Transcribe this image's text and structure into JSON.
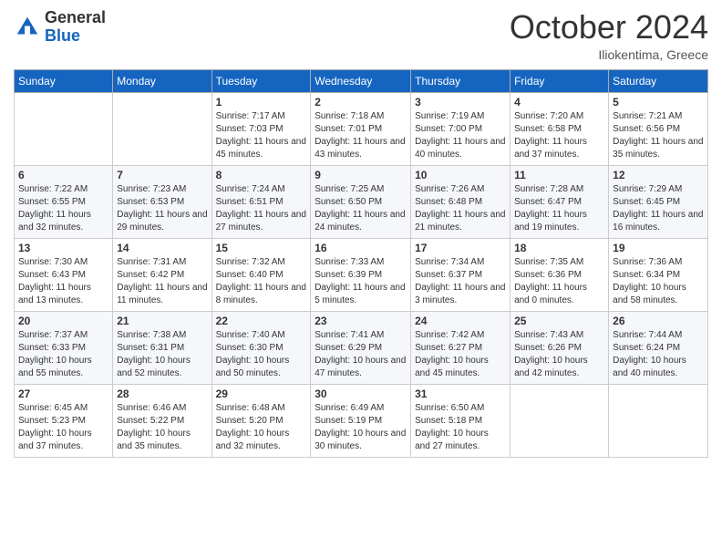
{
  "logo": {
    "general": "General",
    "blue": "Blue"
  },
  "title": "October 2024",
  "location": "Iliokentima, Greece",
  "days_of_week": [
    "Sunday",
    "Monday",
    "Tuesday",
    "Wednesday",
    "Thursday",
    "Friday",
    "Saturday"
  ],
  "weeks": [
    [
      {
        "day": "",
        "info": ""
      },
      {
        "day": "",
        "info": ""
      },
      {
        "day": "1",
        "sunrise": "Sunrise: 7:17 AM",
        "sunset": "Sunset: 7:03 PM",
        "daylight": "Daylight: 11 hours and 45 minutes."
      },
      {
        "day": "2",
        "sunrise": "Sunrise: 7:18 AM",
        "sunset": "Sunset: 7:01 PM",
        "daylight": "Daylight: 11 hours and 43 minutes."
      },
      {
        "day": "3",
        "sunrise": "Sunrise: 7:19 AM",
        "sunset": "Sunset: 7:00 PM",
        "daylight": "Daylight: 11 hours and 40 minutes."
      },
      {
        "day": "4",
        "sunrise": "Sunrise: 7:20 AM",
        "sunset": "Sunset: 6:58 PM",
        "daylight": "Daylight: 11 hours and 37 minutes."
      },
      {
        "day": "5",
        "sunrise": "Sunrise: 7:21 AM",
        "sunset": "Sunset: 6:56 PM",
        "daylight": "Daylight: 11 hours and 35 minutes."
      }
    ],
    [
      {
        "day": "6",
        "sunrise": "Sunrise: 7:22 AM",
        "sunset": "Sunset: 6:55 PM",
        "daylight": "Daylight: 11 hours and 32 minutes."
      },
      {
        "day": "7",
        "sunrise": "Sunrise: 7:23 AM",
        "sunset": "Sunset: 6:53 PM",
        "daylight": "Daylight: 11 hours and 29 minutes."
      },
      {
        "day": "8",
        "sunrise": "Sunrise: 7:24 AM",
        "sunset": "Sunset: 6:51 PM",
        "daylight": "Daylight: 11 hours and 27 minutes."
      },
      {
        "day": "9",
        "sunrise": "Sunrise: 7:25 AM",
        "sunset": "Sunset: 6:50 PM",
        "daylight": "Daylight: 11 hours and 24 minutes."
      },
      {
        "day": "10",
        "sunrise": "Sunrise: 7:26 AM",
        "sunset": "Sunset: 6:48 PM",
        "daylight": "Daylight: 11 hours and 21 minutes."
      },
      {
        "day": "11",
        "sunrise": "Sunrise: 7:28 AM",
        "sunset": "Sunset: 6:47 PM",
        "daylight": "Daylight: 11 hours and 19 minutes."
      },
      {
        "day": "12",
        "sunrise": "Sunrise: 7:29 AM",
        "sunset": "Sunset: 6:45 PM",
        "daylight": "Daylight: 11 hours and 16 minutes."
      }
    ],
    [
      {
        "day": "13",
        "sunrise": "Sunrise: 7:30 AM",
        "sunset": "Sunset: 6:43 PM",
        "daylight": "Daylight: 11 hours and 13 minutes."
      },
      {
        "day": "14",
        "sunrise": "Sunrise: 7:31 AM",
        "sunset": "Sunset: 6:42 PM",
        "daylight": "Daylight: 11 hours and 11 minutes."
      },
      {
        "day": "15",
        "sunrise": "Sunrise: 7:32 AM",
        "sunset": "Sunset: 6:40 PM",
        "daylight": "Daylight: 11 hours and 8 minutes."
      },
      {
        "day": "16",
        "sunrise": "Sunrise: 7:33 AM",
        "sunset": "Sunset: 6:39 PM",
        "daylight": "Daylight: 11 hours and 5 minutes."
      },
      {
        "day": "17",
        "sunrise": "Sunrise: 7:34 AM",
        "sunset": "Sunset: 6:37 PM",
        "daylight": "Daylight: 11 hours and 3 minutes."
      },
      {
        "day": "18",
        "sunrise": "Sunrise: 7:35 AM",
        "sunset": "Sunset: 6:36 PM",
        "daylight": "Daylight: 11 hours and 0 minutes."
      },
      {
        "day": "19",
        "sunrise": "Sunrise: 7:36 AM",
        "sunset": "Sunset: 6:34 PM",
        "daylight": "Daylight: 10 hours and 58 minutes."
      }
    ],
    [
      {
        "day": "20",
        "sunrise": "Sunrise: 7:37 AM",
        "sunset": "Sunset: 6:33 PM",
        "daylight": "Daylight: 10 hours and 55 minutes."
      },
      {
        "day": "21",
        "sunrise": "Sunrise: 7:38 AM",
        "sunset": "Sunset: 6:31 PM",
        "daylight": "Daylight: 10 hours and 52 minutes."
      },
      {
        "day": "22",
        "sunrise": "Sunrise: 7:40 AM",
        "sunset": "Sunset: 6:30 PM",
        "daylight": "Daylight: 10 hours and 50 minutes."
      },
      {
        "day": "23",
        "sunrise": "Sunrise: 7:41 AM",
        "sunset": "Sunset: 6:29 PM",
        "daylight": "Daylight: 10 hours and 47 minutes."
      },
      {
        "day": "24",
        "sunrise": "Sunrise: 7:42 AM",
        "sunset": "Sunset: 6:27 PM",
        "daylight": "Daylight: 10 hours and 45 minutes."
      },
      {
        "day": "25",
        "sunrise": "Sunrise: 7:43 AM",
        "sunset": "Sunset: 6:26 PM",
        "daylight": "Daylight: 10 hours and 42 minutes."
      },
      {
        "day": "26",
        "sunrise": "Sunrise: 7:44 AM",
        "sunset": "Sunset: 6:24 PM",
        "daylight": "Daylight: 10 hours and 40 minutes."
      }
    ],
    [
      {
        "day": "27",
        "sunrise": "Sunrise: 6:45 AM",
        "sunset": "Sunset: 5:23 PM",
        "daylight": "Daylight: 10 hours and 37 minutes."
      },
      {
        "day": "28",
        "sunrise": "Sunrise: 6:46 AM",
        "sunset": "Sunset: 5:22 PM",
        "daylight": "Daylight: 10 hours and 35 minutes."
      },
      {
        "day": "29",
        "sunrise": "Sunrise: 6:48 AM",
        "sunset": "Sunset: 5:20 PM",
        "daylight": "Daylight: 10 hours and 32 minutes."
      },
      {
        "day": "30",
        "sunrise": "Sunrise: 6:49 AM",
        "sunset": "Sunset: 5:19 PM",
        "daylight": "Daylight: 10 hours and 30 minutes."
      },
      {
        "day": "31",
        "sunrise": "Sunrise: 6:50 AM",
        "sunset": "Sunset: 5:18 PM",
        "daylight": "Daylight: 10 hours and 27 minutes."
      },
      {
        "day": "",
        "info": ""
      },
      {
        "day": "",
        "info": ""
      }
    ]
  ]
}
